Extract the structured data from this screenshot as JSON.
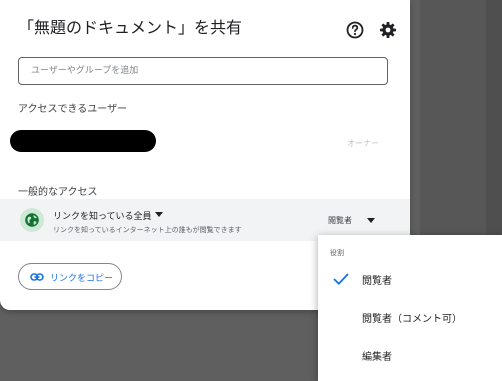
{
  "dialog": {
    "title": "「無題のドキュメント」を共有",
    "search_placeholder": "ユーザーやグループを追加",
    "users_section_label": "アクセスできるユーザー",
    "owner_role": "オーナー",
    "general_access_label": "一般的なアクセス",
    "access": {
      "title": "リンクを知っている全員",
      "description": "リンクを知っているインターネット上の誰もが閲覧できます",
      "role": "閲覧者"
    },
    "copy_link_label": "リンクをコピー"
  },
  "role_menu": {
    "header": "役割",
    "items": [
      {
        "label": "閲覧者",
        "selected": true
      },
      {
        "label": "閲覧者（コメント可）",
        "selected": false
      },
      {
        "label": "編集者",
        "selected": false
      }
    ]
  },
  "colors": {
    "accent": "#1a73e8",
    "globe_bg": "#ceead6",
    "globe_fg": "#137333",
    "overlay": "#5f5f5f"
  },
  "icons": {
    "help": "help-circle-icon",
    "settings": "gear-icon",
    "globe": "globe-icon",
    "link": "link-icon",
    "check": "check-icon",
    "caret": "caret-down-icon"
  }
}
